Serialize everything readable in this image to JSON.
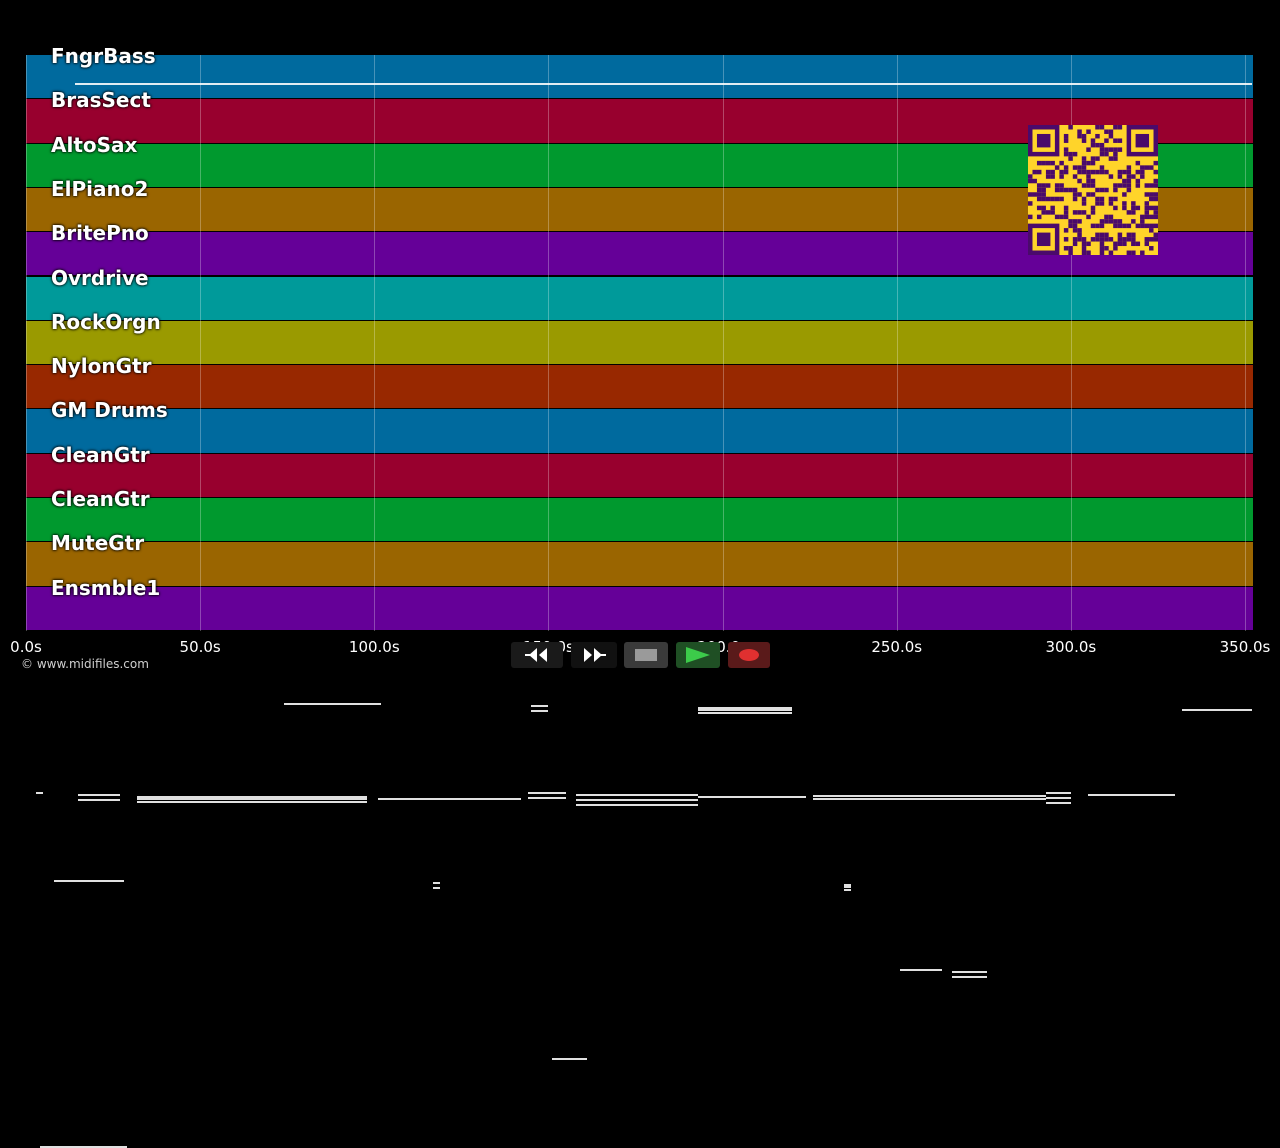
{
  "tracks": [
    {
      "name": "FngrBass",
      "color": "#006a9e"
    },
    {
      "name": "BrasSect",
      "color": "#98002e"
    },
    {
      "name": "AltoSax",
      "color": "#00992e"
    },
    {
      "name": "ElPiano2",
      "color": "#9a6500"
    },
    {
      "name": "BritePno",
      "color": "#650098"
    },
    {
      "name": "Ovrdrive",
      "color": "#009a9a"
    },
    {
      "name": "RockOrgn",
      "color": "#9a9a00"
    },
    {
      "name": "NylonGtr",
      "color": "#982800"
    },
    {
      "name": "GM Drums",
      "color": "#006a9e"
    },
    {
      "name": "CleanGtr",
      "color": "#98002e"
    },
    {
      "name": "CleanGtr",
      "color": "#00992e"
    },
    {
      "name": "MuteGtr",
      "color": "#9a6500"
    },
    {
      "name": "Ensmble1",
      "color": "#650098"
    }
  ],
  "axis": {
    "ticks": [
      "0.0s",
      "50.0s",
      "100.0s",
      "150.0s",
      "200.0s",
      "250.0s",
      "300.0s",
      "350.0s"
    ],
    "tick_values": [
      0,
      50,
      100,
      150,
      200,
      250,
      300,
      350
    ],
    "range": [
      0,
      352
    ]
  },
  "copyright": "© www.midifiles.com",
  "transport": {
    "rewind_icon": "rewind-icon",
    "fast_forward_icon": "fast-forward-icon",
    "stop_icon": "stop-icon",
    "play_icon": "play-icon",
    "record_icon": "record-icon"
  },
  "colors": {
    "background": "#000000",
    "qr": "#ffd42a",
    "qr_dark": "#4a0a6b"
  },
  "notes": [
    [
      [
        14,
        352
      ]
    ],
    [
      [
        81,
        95
      ],
      [
        101,
        116
      ],
      [
        198,
        215
      ],
      [
        220,
        247
      ],
      [
        267,
        298
      ],
      [
        302,
        331
      ]
    ],
    [
      [
        27,
        38
      ],
      [
        40,
        75
      ],
      [
        81,
        100
      ],
      [
        103,
        142
      ],
      [
        153,
        186
      ],
      [
        193,
        211
      ],
      [
        217,
        256
      ],
      [
        267,
        285
      ],
      [
        330,
        339
      ]
    ],
    [
      [
        5,
        30
      ],
      [
        34,
        75
      ],
      [
        102,
        115
      ],
      [
        134,
        170
      ],
      [
        176,
        197
      ],
      [
        219,
        241
      ],
      [
        332,
        352
      ]
    ],
    [
      [
        13,
        22
      ],
      [
        77,
        82
      ],
      [
        90,
        94
      ],
      [
        122,
        148
      ],
      [
        150,
        157
      ],
      [
        162,
        166
      ],
      [
        173,
        193
      ],
      [
        197,
        200
      ],
      [
        206,
        210
      ],
      [
        234,
        275
      ],
      [
        282,
        294
      ],
      [
        312,
        352
      ]
    ],
    [
      [
        15,
        22
      ],
      [
        53,
        64
      ],
      [
        74,
        103
      ],
      [
        122,
        128
      ],
      [
        133,
        148
      ],
      [
        171,
        183
      ],
      [
        193,
        221
      ],
      [
        240,
        246
      ],
      [
        251,
        335
      ]
    ],
    [
      [
        17,
        26
      ],
      [
        51,
        75
      ],
      [
        75,
        102
      ],
      [
        101,
        123
      ],
      [
        168,
        183
      ],
      [
        185,
        221
      ],
      [
        221,
        240
      ],
      [
        252,
        288
      ],
      [
        293,
        340
      ]
    ],
    [
      [
        74,
        102
      ],
      [
        145,
        150
      ],
      [
        193,
        220
      ],
      [
        332,
        352
      ]
    ],
    [
      [
        3,
        5
      ],
      [
        15,
        27
      ],
      [
        32,
        98
      ],
      [
        101,
        142
      ],
      [
        144,
        155
      ],
      [
        158,
        193
      ],
      [
        193,
        224
      ],
      [
        226,
        293
      ],
      [
        293,
        300
      ],
      [
        305,
        330
      ]
    ],
    [
      [
        8,
        28
      ],
      [
        117,
        119
      ],
      [
        235,
        237
      ]
    ],
    [
      [
        251,
        263
      ],
      [
        266,
        276
      ]
    ],
    [
      [
        151,
        161
      ]
    ],
    [
      [
        4,
        29
      ]
    ]
  ]
}
